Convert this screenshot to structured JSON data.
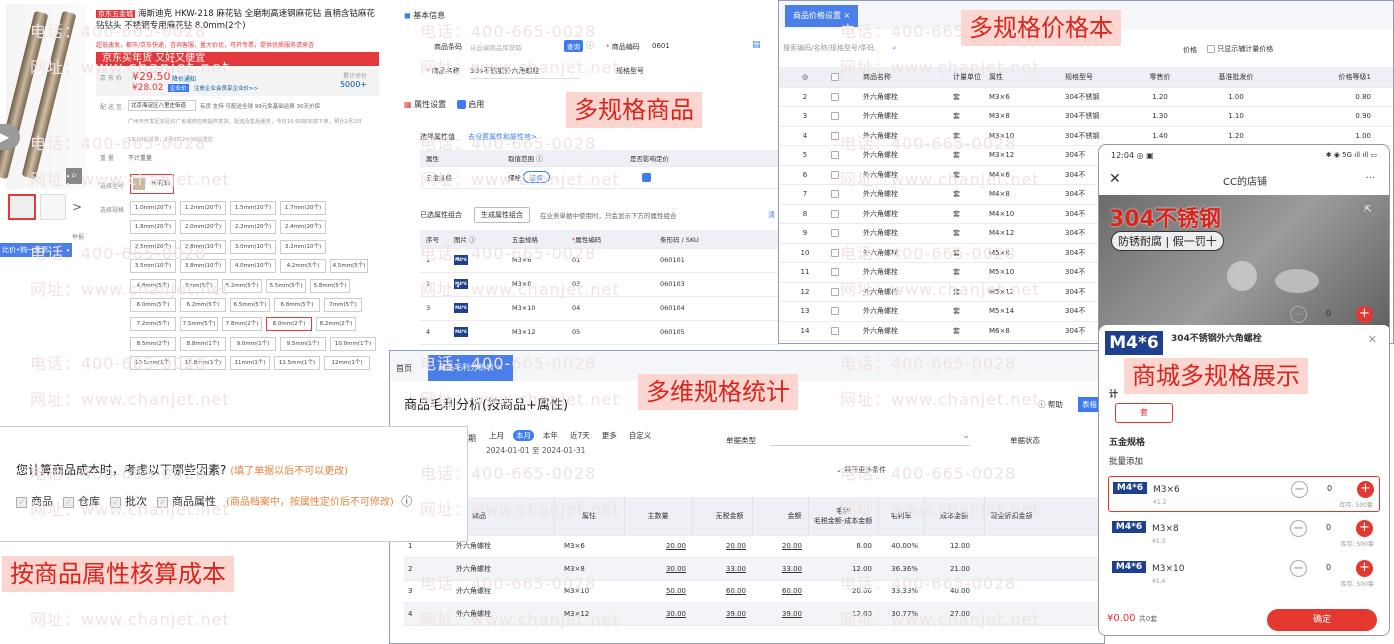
{
  "watermark": {
    "phone": "电话：400-665-0028",
    "site": "网址：www.chanjet.net"
  },
  "tags": {
    "multi_spec_goods": "多规格商品",
    "multi_spec_price": "多规格价格本",
    "multi_dim_stat": "多维规格统计",
    "mall_display": "商城多规格展示",
    "cost_by_attr": "按商品属性核算成本"
  },
  "jd": {
    "badge": "京东五金城",
    "title": "海斯迪克 HKW-218 麻花钻 全磨制高速钢麻花钻 直柄含钴麻花钻钻头 不锈钢专用麻花钻 8.0mm(2个)",
    "promo": "超低速发，都市/京东快递，咨询客服，量大价优，可开专票，提供优质服务请来咨",
    "banner": "京东买年货 又好又便宜",
    "price_label": "京 东 价",
    "price": "¥29.50",
    "price_note": "降价通知",
    "price2": "¥28.02",
    "price2_tag": "企业价",
    "price2_note": "注册企业会员享企业价>>",
    "review_label": "累计评价",
    "review_count": "5000+",
    "ship_label": "配 送 至",
    "ship_value": "北京海淀区八里庄街道",
    "ship_note": "有货 支持 可配送全球 99元免基础运费 30天价保",
    "notice": "广州市开发区东区红广省城供应商提供发货，配送及售后服务，今日16:00前完成下单，预计2月2日",
    "notice2": "19:00前发货，2月4日24:00前送达",
    "weight_label": "重 量",
    "weight": "不计重量",
    "type_label": "选择型号",
    "type_value": "麻花钻",
    "spec_label": "选择规格",
    "specs": [
      "1.0mm(20个)",
      "1.2mm(20个)",
      "1.5mm(20个)",
      "1.7mm(20个)",
      "1.8mm(20个)",
      "2.0mm(20个)",
      "2.2mm(20个)",
      "2.4mm(20个)",
      "2.5mm(20个)",
      "2.8mm(10个)",
      "3.0mm(10个)",
      "3.2mm(10个)",
      "3.5mm(10个)",
      "3.8mm(10个)",
      "4.0mm(10个)",
      "4.2mm(5个)",
      "4.5mm(5个)",
      "4.8mm(5个)",
      "5mm(5个)",
      "5.2mm(5个)",
      "5.5mm(5个)",
      "5.8mm(5个)",
      "6.0mm(5个)",
      "6.2mm(5个)",
      "6.5mm(5个)",
      "6.8mm(5个)",
      "7mm(5个)",
      "7.2mm(5个)",
      "7.5mm(5个)",
      "7.8mm(2个)",
      "8.0mm(2个)",
      "8.2mm(2个)",
      "8.5mm(2个)",
      "8.8mm(1个)",
      "9.0mm(1个)",
      "9.5mm(1个)",
      "10.0mm(1个)",
      "10.5mm(1个)",
      "10.8mm(1个)",
      "11mm(1个)",
      "11.5mm(1个)",
      "12mm(1个)"
    ],
    "selected_spec": "8.0mm(2个)",
    "side_link": "比价•购一开票",
    "side_note": "举报"
  },
  "goods": {
    "section": "基本信息",
    "barcode_label": "商品条码",
    "barcode_ph": "从云端商品库获取",
    "query_btn": "查询",
    "code_label": "商品编码",
    "code": "0601",
    "name_label": "商品名称",
    "name": "304不锈钢外六角螺栓",
    "model_label": "规格型号",
    "attr_section": "属性设置",
    "enable": "启用",
    "attr_select_label": "选择属性值",
    "attr_link": "去设置属性和属性值>",
    "attr_headers": [
      "属性",
      "取值范围",
      "是否影响定价"
    ],
    "attr_row": [
      "五金规格",
      "螺栓"
    ],
    "select_btn": "选择",
    "combo_label": "已选属性组合",
    "combo_btn": "生成属性组合",
    "combo_tip": "在业务单据中使用时，只会显示下方的属性组合",
    "clear": "清",
    "combo_headers": [
      "序号",
      "图片",
      "五金规格",
      "属性编码",
      "条形码 / SKU"
    ],
    "combo_rows": [
      [
        "1",
        "M3×6",
        "01",
        "060101"
      ],
      [
        "2",
        "M3×8",
        "03",
        "060103"
      ],
      [
        "3",
        "M3×10",
        "04",
        "060104"
      ],
      [
        "4",
        "M3×12",
        "05",
        "060105"
      ]
    ]
  },
  "price": {
    "tab": "商品价格设置",
    "search_ph": "搜索编码/名称/规格型号/条码",
    "price_chk": "价格",
    "only_aux": "只显示辅计量价格",
    "headers": [
      "",
      "",
      "商品名称",
      "计量单位",
      "属性",
      "规格型号",
      "零售价",
      "基准批发价",
      "价格等级1"
    ],
    "rows": [
      [
        "2",
        "外六角螺栓",
        "套",
        "M3×6",
        "304不锈钢",
        "1.20",
        "1.00",
        "0.80"
      ],
      [
        "3",
        "外六角螺栓",
        "套",
        "M3×8",
        "304不锈钢",
        "1.30",
        "1.10",
        "0.90"
      ],
      [
        "4",
        "外六角螺栓",
        "套",
        "M3×10",
        "304不锈钢",
        "1.40",
        "1.20",
        "1.00"
      ],
      [
        "5",
        "外六角螺栓",
        "套",
        "M3×12",
        "304不",
        "",
        "",
        ""
      ],
      [
        "6",
        "外六角螺栓",
        "套",
        "M4×6",
        "304不",
        "",
        "",
        ""
      ],
      [
        "7",
        "外六角螺栓",
        "套",
        "M4×8",
        "304不",
        "",
        "",
        ""
      ],
      [
        "8",
        "外六角螺栓",
        "套",
        "M4×10",
        "304不",
        "",
        "",
        ""
      ],
      [
        "9",
        "外六角螺栓",
        "套",
        "M4×12",
        "304不",
        "",
        "",
        ""
      ],
      [
        "10",
        "外六角螺栓",
        "套",
        "M5×8",
        "304不",
        "",
        "",
        ""
      ],
      [
        "11",
        "外六角螺栓",
        "套",
        "M5×10",
        "304不",
        "",
        "",
        ""
      ],
      [
        "12",
        "外六角螺栓",
        "套",
        "M5×12",
        "304不",
        "",
        "",
        ""
      ],
      [
        "13",
        "外六角螺栓",
        "套",
        "M5×14",
        "304不",
        "",
        "",
        ""
      ],
      [
        "14",
        "外六角螺栓",
        "套",
        "M6×8",
        "304不",
        "",
        "",
        ""
      ]
    ]
  },
  "profit": {
    "home": "首页",
    "tab": "商品毛利分析表",
    "title": "商品毛利分析(按商品+属性)",
    "help": "帮助",
    "table_btn": "表格",
    "period_label": "期",
    "periods": [
      "上月",
      "本月",
      "本年",
      "近7天",
      "更多",
      "自定义"
    ],
    "range": "2024-01-01 至 2024-01-31",
    "doc_type": "单据类型",
    "doc_status": "单据状态",
    "more": "展开更多条件",
    "headers": [
      "",
      "商品",
      "属性",
      "主数量",
      "无税金额",
      "金额",
      "毛利\n毛税金额-成本金额",
      "毛利率",
      "成本金额",
      "现金折扣金额"
    ],
    "rows": [
      [
        "1",
        "外六角螺栓",
        "M3×6",
        "20.00",
        "20.00",
        "20.00",
        "8.00",
        "40.00%",
        "12.00"
      ],
      [
        "2",
        "外六角螺栓",
        "M3×8",
        "30.00",
        "33.00",
        "33.00",
        "12.00",
        "36.36%",
        "21.00"
      ],
      [
        "3",
        "外六角螺栓",
        "M3×10",
        "50.00",
        "60.00",
        "60.00",
        "20.00",
        "33.33%",
        "40.00"
      ],
      [
        "4",
        "外六角螺栓",
        "M3×12",
        "30.00",
        "39.00",
        "39.00",
        "12.00",
        "30.77%",
        "27.00"
      ]
    ]
  },
  "cost": {
    "question": "您计算商品成本时，考虑以下哪些因素?",
    "hint": "(填了单据以后不可以更改)",
    "opts": [
      "商品",
      "仓库",
      "批次",
      "商品属性"
    ],
    "attr_hint": "(商品档案中，按属性定价后不可修改)"
  },
  "phone": {
    "time": "12:04",
    "status": "5G",
    "shop": "CC的店铺",
    "banner_title": "304不锈钢",
    "banner_sub": "防锈耐腐 | 假一罚十",
    "product": "304不锈钢外六角螺栓",
    "logo": "M4*6",
    "unit_label": "计",
    "unit": "套",
    "group": "五金规格",
    "batch": "批量添加",
    "qty": "0",
    "skus": [
      {
        "name": "M3×6",
        "price": "¥1.2",
        "stock": "库存: 500套"
      },
      {
        "name": "M3×8",
        "price": "¥1.3",
        "stock": "库存: 500套"
      },
      {
        "name": "M3×10",
        "price": "¥1.4",
        "stock": "库存: 500套"
      }
    ],
    "total": "¥0.00",
    "total_count": "共0套",
    "confirm": "确定"
  }
}
